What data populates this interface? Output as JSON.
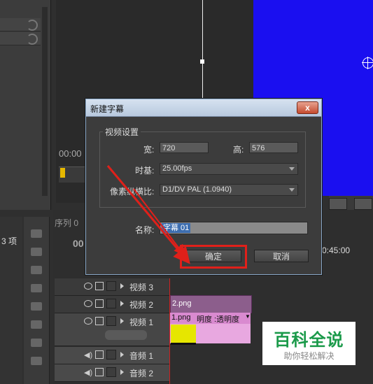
{
  "timeline": {
    "timecode_left": "00:00",
    "timecode_big": "00",
    "timecode_right": "0:45:00",
    "items_count": "3 项",
    "sequence_tab": "序列 0",
    "tracks": [
      {
        "name": "视频 3"
      },
      {
        "name": "视频 2"
      },
      {
        "name": "视频 1"
      },
      {
        "name": "音频 1"
      },
      {
        "name": "音频 2"
      }
    ],
    "clip_v2": "2.png",
    "clip_v1": "1.png",
    "clip_v1_effect": "明度 :透明度"
  },
  "dialog": {
    "title": "新建字幕",
    "close_label": "x",
    "group_title": "视频设置",
    "width_label": "宽:",
    "width_value": "720",
    "height_label": "高:",
    "height_value": "576",
    "timebase_label": "时基:",
    "timebase_value": "25.00fps",
    "pixel_aspect_label": "像素纵横比:",
    "pixel_aspect_value": "D1/DV PAL (1.0940)",
    "name_label": "名称:",
    "name_value": "字幕 01",
    "ok_label": "确定",
    "cancel_label": "取消"
  },
  "watermark": {
    "title": "百科全说",
    "subtitle": "助你轻松解决"
  },
  "colors": {
    "program_background": "#1a0ff0",
    "highlight": "#e0201a",
    "clip_video": "#e8a8e0",
    "watermark_green": "#1b9a4a"
  }
}
